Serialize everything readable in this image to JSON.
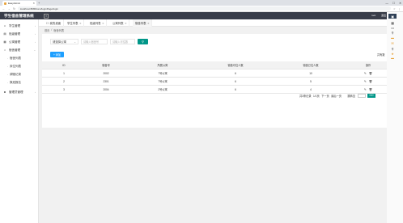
{
  "browser": {
    "tab_title": "EasyAdmin",
    "url": "localhost:8080/ssm/loginPage/login",
    "window_controls": [
      "—",
      "☐",
      "✕"
    ]
  },
  "app": {
    "title": "学生宿舍管理系统",
    "user": "root",
    "exit": "退出"
  },
  "sidebar": {
    "items": [
      {
        "label": "学生管理",
        "icon": "user-icon"
      },
      {
        "label": "班级管理",
        "icon": "class-icon"
      },
      {
        "label": "公寓管理",
        "icon": "building-icon"
      },
      {
        "label": "宿舍管理",
        "icon": "home-icon"
      }
    ],
    "sub_items": [
      "宿舍列表",
      "床位列表",
      "调宿记录",
      "换班报名"
    ],
    "items2": [
      {
        "label": "管理员管理",
        "icon": "admin-icon"
      }
    ]
  },
  "page_tabs": [
    {
      "label": "我的桌面",
      "closable": false
    },
    {
      "label": "学生列表",
      "closable": true
    },
    {
      "label": "班级列表",
      "closable": true
    },
    {
      "label": "公寓列表",
      "closable": true
    },
    {
      "label": "宿舍列表",
      "closable": true
    }
  ],
  "breadcrumb": [
    "首页",
    "宿舍列表"
  ],
  "filters": {
    "select_value": "请选择公寓",
    "dorm_placeholder": "请输入宿舍号",
    "capacity_placeholder": "请输入可住数"
  },
  "actions": {
    "add_label": "+ 添加",
    "total_text": "共有数"
  },
  "table": {
    "columns": [
      "ID",
      "宿舍号",
      "所属公寓",
      "宿舍可住人数",
      "宿舍已住人数",
      "操作"
    ],
    "rows": [
      [
        "1",
        "2002",
        "7号公寓",
        "6",
        "10"
      ],
      [
        "2",
        "2301",
        "7号公寓",
        "6",
        "5"
      ],
      [
        "3",
        "2004",
        "2号公寓",
        "6",
        "4"
      ]
    ]
  },
  "pager": {
    "total": "共3条记录",
    "pages": "1/1页",
    "next": "下一页",
    "last": "最后一页",
    "goto": "跳转至",
    "go": "GO"
  },
  "colors": {
    "header_bg": "#393d49",
    "primary": "#009688",
    "blue": "#1e9fff"
  }
}
